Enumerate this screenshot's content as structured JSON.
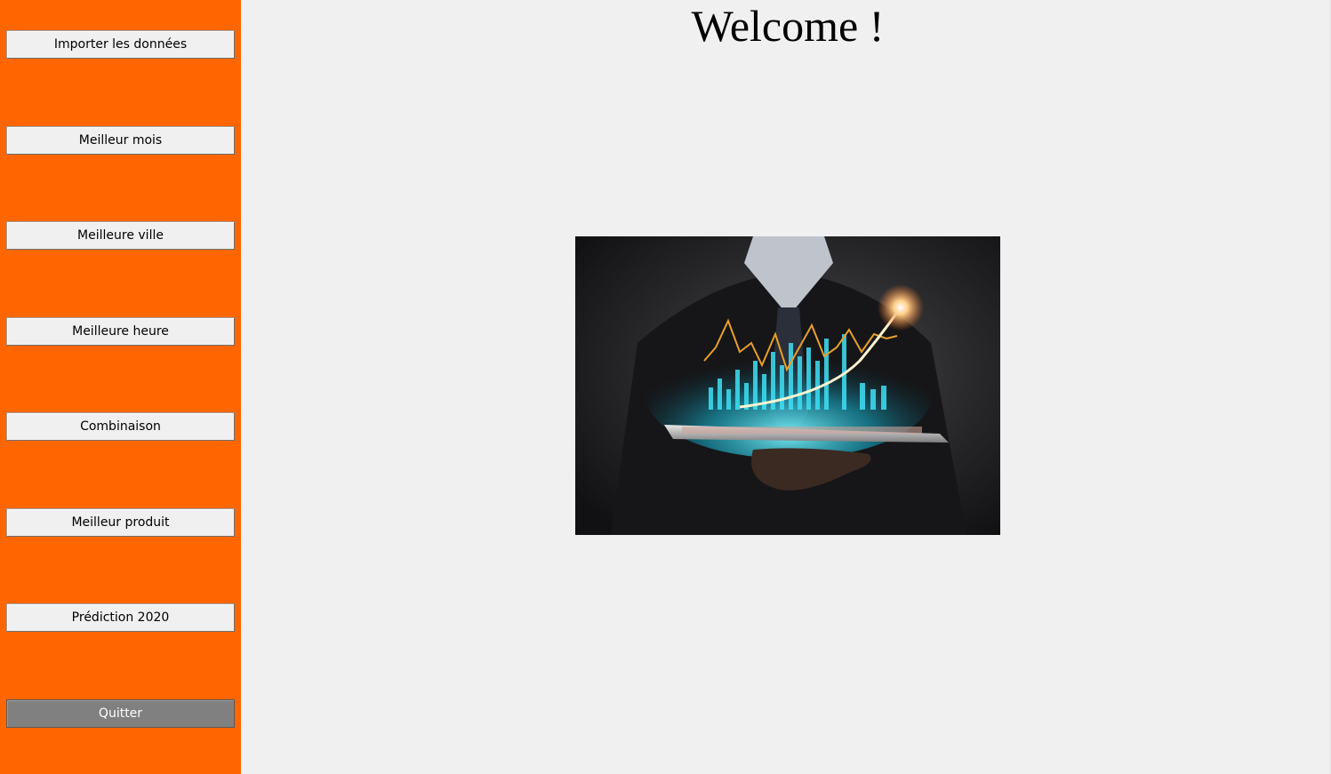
{
  "window": {
    "title": "Welcome !"
  },
  "sidebar": {
    "background": "#ff6600",
    "buttons": [
      {
        "label": "Importer les données"
      },
      {
        "label": "Meilleur mois"
      },
      {
        "label": "Meilleure ville"
      },
      {
        "label": "Meilleure heure"
      },
      {
        "label": "Combinaison"
      },
      {
        "label": "Meilleur produit"
      },
      {
        "label": "Prédiction 2020"
      }
    ],
    "quit_label": "Quitter"
  },
  "main": {
    "background": "#f0f0f0",
    "hero_image": {
      "icon": "business-analytics-illustration"
    }
  }
}
